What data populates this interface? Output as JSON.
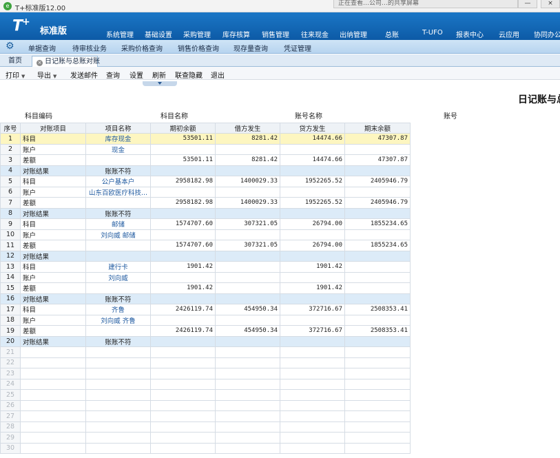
{
  "window": {
    "title": "T+标准版12.00",
    "overlay_text": "正在查看…公司…的共享屏幕",
    "min_label": "—",
    "close_label": "×"
  },
  "header": {
    "logo": "T",
    "logo_plus": "+",
    "logo_sub": "标准版",
    "modules": [
      "系统管理",
      "基础设置",
      "采购管理",
      "库存核算",
      "销售管理",
      "往来现金",
      "出纳管理",
      "总账",
      "T-UFO",
      "报表中心",
      "云应用",
      "协同办公"
    ]
  },
  "subnav": {
    "items": [
      "单据查询",
      "待审核业务",
      "采购价格查询",
      "销售价格查询",
      "现存量查询",
      "凭证管理"
    ]
  },
  "tabs": {
    "home": "首页",
    "active": "日记账与总账对账"
  },
  "toolbar": {
    "print": "打印",
    "export": "导出",
    "send_mail": "发送邮件",
    "query": "查询",
    "settings": "设置",
    "refresh": "刷新",
    "hide": "联查隐藏",
    "exit": "退出"
  },
  "report": {
    "title": "日记账与总账对账"
  },
  "filters": {
    "subject_code": "科目编码",
    "subject_name": "科目名称",
    "account_name": "账号名称",
    "account_no": "账号"
  },
  "grid": {
    "columns": [
      "序号",
      "对账项目",
      "项目名称",
      "期初余额",
      "借方发生",
      "贷方发生",
      "期末余额"
    ],
    "rows": [
      {
        "seq": "1",
        "item": "科目",
        "name": "库存现金",
        "open": "53501.11",
        "debit": "8281.42",
        "credit": "14474.66",
        "close": "47307.87",
        "kind": "selected"
      },
      {
        "seq": "2",
        "item": "账户",
        "name": "现金",
        "open": "",
        "debit": "",
        "credit": "",
        "close": "",
        "kind": ""
      },
      {
        "seq": "3",
        "item": "差额",
        "name": "",
        "open": "53501.11",
        "debit": "8281.42",
        "credit": "14474.66",
        "close": "47307.87",
        "kind": ""
      },
      {
        "seq": "4",
        "item": "对账结果",
        "name": "账账不符",
        "open": "",
        "debit": "",
        "credit": "",
        "close": "",
        "kind": "result"
      },
      {
        "seq": "5",
        "item": "科目",
        "name": "公户基本户",
        "open": "2958182.98",
        "debit": "1400029.33",
        "credit": "1952265.52",
        "close": "2405946.79",
        "kind": ""
      },
      {
        "seq": "6",
        "item": "账户",
        "name": "山东百欧医疗科技...",
        "open": "",
        "debit": "",
        "credit": "",
        "close": "",
        "kind": ""
      },
      {
        "seq": "7",
        "item": "差额",
        "name": "",
        "open": "2958182.98",
        "debit": "1400029.33",
        "credit": "1952265.52",
        "close": "2405946.79",
        "kind": ""
      },
      {
        "seq": "8",
        "item": "对账结果",
        "name": "账账不符",
        "open": "",
        "debit": "",
        "credit": "",
        "close": "",
        "kind": "result"
      },
      {
        "seq": "9",
        "item": "科目",
        "name": "邮储",
        "open": "1574707.60",
        "debit": "307321.05",
        "credit": "26794.00",
        "close": "1855234.65",
        "kind": ""
      },
      {
        "seq": "10",
        "item": "账户",
        "name": "刘向威 邮储",
        "open": "",
        "debit": "",
        "credit": "",
        "close": "",
        "kind": ""
      },
      {
        "seq": "11",
        "item": "差额",
        "name": "",
        "open": "1574707.60",
        "debit": "307321.05",
        "credit": "26794.00",
        "close": "1855234.65",
        "kind": ""
      },
      {
        "seq": "12",
        "item": "对账结果",
        "name": "",
        "open": "",
        "debit": "",
        "credit": "",
        "close": "",
        "kind": "result"
      },
      {
        "seq": "13",
        "item": "科目",
        "name": "建行卡",
        "open": "1901.42",
        "debit": "",
        "credit": "1901.42",
        "close": "",
        "kind": ""
      },
      {
        "seq": "14",
        "item": "账户",
        "name": "刘向威",
        "open": "",
        "debit": "",
        "credit": "",
        "close": "",
        "kind": ""
      },
      {
        "seq": "15",
        "item": "差额",
        "name": "",
        "open": "1901.42",
        "debit": "",
        "credit": "1901.42",
        "close": "",
        "kind": ""
      },
      {
        "seq": "16",
        "item": "对账结果",
        "name": "账账不符",
        "open": "",
        "debit": "",
        "credit": "",
        "close": "",
        "kind": "result"
      },
      {
        "seq": "17",
        "item": "科目",
        "name": "齐鲁",
        "open": "2426119.74",
        "debit": "454950.34",
        "credit": "372716.67",
        "close": "2508353.41",
        "kind": ""
      },
      {
        "seq": "18",
        "item": "账户",
        "name": "刘向威 齐鲁",
        "open": "",
        "debit": "",
        "credit": "",
        "close": "",
        "kind": ""
      },
      {
        "seq": "19",
        "item": "差额",
        "name": "",
        "open": "2426119.74",
        "debit": "454950.34",
        "credit": "372716.67",
        "close": "2508353.41",
        "kind": ""
      },
      {
        "seq": "20",
        "item": "对账结果",
        "name": "账账不符",
        "open": "",
        "debit": "",
        "credit": "",
        "close": "",
        "kind": "result"
      },
      {
        "seq": "21",
        "item": "",
        "name": "",
        "open": "",
        "debit": "",
        "credit": "",
        "close": "",
        "kind": "empty"
      },
      {
        "seq": "22",
        "item": "",
        "name": "",
        "open": "",
        "debit": "",
        "credit": "",
        "close": "",
        "kind": "empty"
      },
      {
        "seq": "23",
        "item": "",
        "name": "",
        "open": "",
        "debit": "",
        "credit": "",
        "close": "",
        "kind": "empty"
      },
      {
        "seq": "24",
        "item": "",
        "name": "",
        "open": "",
        "debit": "",
        "credit": "",
        "close": "",
        "kind": "empty"
      },
      {
        "seq": "25",
        "item": "",
        "name": "",
        "open": "",
        "debit": "",
        "credit": "",
        "close": "",
        "kind": "empty"
      },
      {
        "seq": "26",
        "item": "",
        "name": "",
        "open": "",
        "debit": "",
        "credit": "",
        "close": "",
        "kind": "empty"
      },
      {
        "seq": "27",
        "item": "",
        "name": "",
        "open": "",
        "debit": "",
        "credit": "",
        "close": "",
        "kind": "empty"
      },
      {
        "seq": "28",
        "item": "",
        "name": "",
        "open": "",
        "debit": "",
        "credit": "",
        "close": "",
        "kind": "empty"
      },
      {
        "seq": "29",
        "item": "",
        "name": "",
        "open": "",
        "debit": "",
        "credit": "",
        "close": "",
        "kind": "empty"
      },
      {
        "seq": "30",
        "item": "",
        "name": "",
        "open": "",
        "debit": "",
        "credit": "",
        "close": "",
        "kind": "empty"
      }
    ]
  }
}
